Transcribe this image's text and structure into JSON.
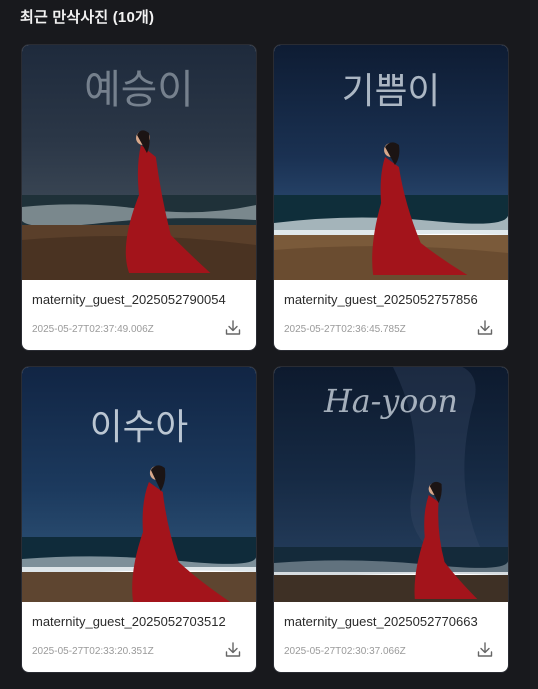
{
  "section": {
    "title": "최근 만삭사진 (10개)"
  },
  "photos": [
    {
      "filename": "maternity_guest_2025052790054",
      "timestamp": "2025-05-27T02:37:49.006Z",
      "sky_text": "예승이",
      "icon": "download-icon"
    },
    {
      "filename": "maternity_guest_2025052757856",
      "timestamp": "2025-05-27T02:36:45.785Z",
      "sky_text": "기쁨이",
      "icon": "download-icon"
    },
    {
      "filename": "maternity_guest_2025052703512",
      "timestamp": "2025-05-27T02:33:20.351Z",
      "sky_text": "이수아",
      "icon": "download-icon"
    },
    {
      "filename": "maternity_guest_2025052770663",
      "timestamp": "2025-05-27T02:30:37.066Z",
      "sky_text": "Ha-yoon",
      "icon": "download-icon"
    }
  ],
  "colors": {
    "background": "#18191d",
    "card": "#ffffff",
    "dress": "#a3141b",
    "sky": "#0f1d33"
  }
}
